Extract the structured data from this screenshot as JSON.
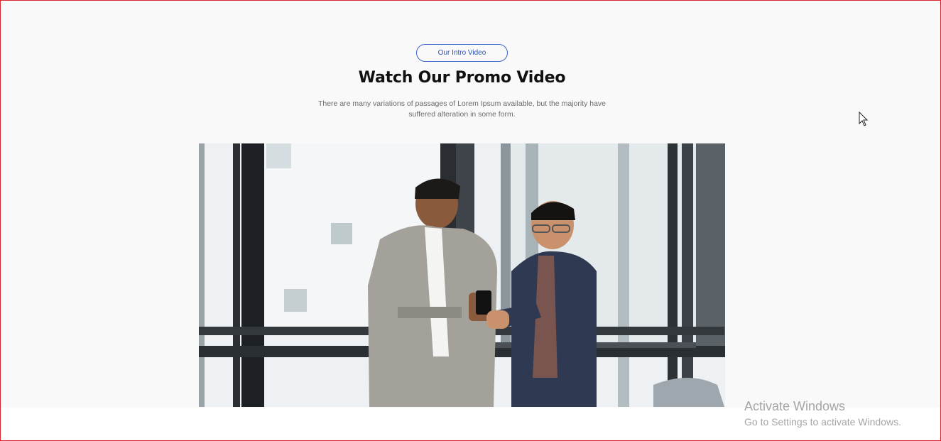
{
  "section": {
    "badge_label": "Our Intro Video",
    "title": "Watch Our Promo Video",
    "description": "There are many variations of passages of Lorem Ipsum available, but the majority have suffered alteration in some form."
  },
  "video": {
    "thumbnail_icon": "promo-video-thumbnail"
  },
  "watermark": {
    "title": "Activate Windows",
    "subtitle": "Go to Settings to activate Windows."
  },
  "colors": {
    "accent": "#2a52b6",
    "background": "#f9f9fa",
    "frame_border": "#d9242b"
  }
}
